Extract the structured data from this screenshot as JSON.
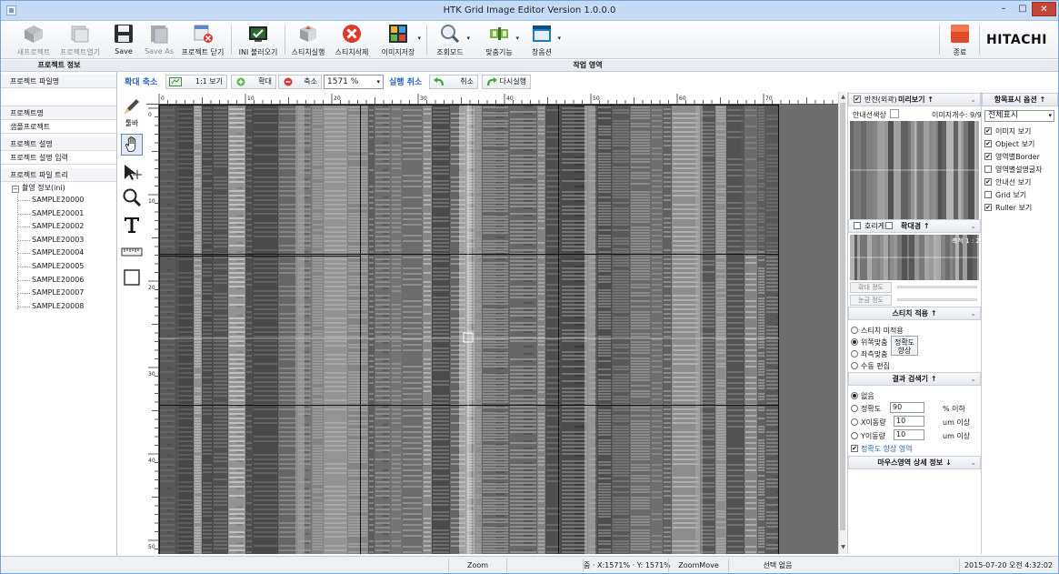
{
  "window": {
    "title": "HTK Grid Image Editor Version 1.0.0.0",
    "minimize": "–",
    "maximize": "□",
    "close": "✕"
  },
  "toolbar": {
    "new_project": "새프로젝트",
    "open_project": "프로젝트열기",
    "save": "Save",
    "save_as": "Save As",
    "close_project": "프로젝트 닫기",
    "load_ini": "INI 불러오기",
    "run_stitch": "스티치실행",
    "delete_stitch": "스티치삭제",
    "save_image": "이미지저장",
    "view_mode": "조회모드",
    "fit": "맞춤기능",
    "window": "창옵션",
    "exit": "종료",
    "brand": "HITACHI"
  },
  "left_panel": {
    "header": "프로젝트 정보",
    "project_file_label": "프로젝트 파일명",
    "project_name_label": "프로젝트명",
    "project_name_value": "샘플프로젝트",
    "project_desc_label": "프로젝트 설명",
    "project_desc_value": "프로젝트 설명 입력",
    "tree_label": "프로젝트 파일 트리",
    "tree_root": "촬영 정보(ini)",
    "tree_root_toggle": "−",
    "tree_items": [
      "SAMPLE20000",
      "SAMPLE20001",
      "SAMPLE20002",
      "SAMPLE20003",
      "SAMPLE20004",
      "SAMPLE20005",
      "SAMPLE20006",
      "SAMPLE20007",
      "SAMPLE20008"
    ]
  },
  "work_area": {
    "header": "작업 영역",
    "zoom_reduce_link": "확대 축소",
    "view_1to1": "1:1 보기",
    "zoom_in": "확대",
    "zoom_out": "축소",
    "zoom_value": "1571 %",
    "undo_link": "실행 취소",
    "undo": "취소",
    "redo": "다시실행",
    "tool_label": "툴바",
    "ruler_top_labels": [
      "0",
      "10",
      "20",
      "30",
      "40",
      "50",
      "60",
      "70"
    ],
    "ruler_left_labels": [
      "0",
      "10",
      "20",
      "30",
      "40",
      "50"
    ]
  },
  "preview_panel": {
    "invert_label": "반전(외곽)",
    "invert_checked": "✔",
    "preview_header": "미리보기 ↑",
    "guide_color_label": "안내선색상",
    "image_count": "이미지개수: 9/9",
    "smooth_label": "호리게",
    "magnifier_header": "확대경 ↑",
    "magnifier_scale": "축척 1 : 2",
    "zoom_strength": "확대 정도",
    "blur_strength": "눈금 정도",
    "stitch_header": "스티치 적용 ↑",
    "stitch_none": "스티치 미적용",
    "stitch_top": "위쪽맞춤",
    "stitch_side": "좌측맞춤",
    "stitch_manual": "수동 편집",
    "accuracy_button": "정확도 향상",
    "result_header": "결과 검색기 ↑",
    "result_none": "없음",
    "result_accuracy": "정확도",
    "result_accuracy_value": "90",
    "result_accuracy_unit": "% 이하",
    "result_x": "X이동량",
    "result_x_value": "10",
    "result_x_unit": "um 이상",
    "result_y": "Y이동량",
    "result_y_value": "10",
    "result_y_unit": "um 이상",
    "result_improve": "정확도 향상 영역",
    "result_improve_checked": "✔",
    "mouse_header": "마우스영역 상세 정보 ↓",
    "chevron": "⌄"
  },
  "display_options": {
    "header": "항목표시 옵션 ↑",
    "combo_value": "전체표시",
    "items": [
      {
        "label": "이미지 보기",
        "checked": "✔"
      },
      {
        "label": "Object 보기",
        "checked": "✔"
      },
      {
        "label": "영역별Border",
        "checked": "✔"
      },
      {
        "label": "영역별설명글자",
        "checked": ""
      },
      {
        "label": "안내선 보기",
        "checked": "✔"
      },
      {
        "label": "Grid 보기",
        "checked": ""
      },
      {
        "label": "Ruller 보기",
        "checked": "✔"
      }
    ]
  },
  "statusbar": {
    "mode": "Zoom",
    "zoom_info": "줌 · X:1571%  · Y: 1571%",
    "move_mode": "ZoomMove",
    "selection": "선택 없음",
    "datetime": "2015-07-20 오전 4:32:02"
  },
  "colors": {
    "title_bar": "#c5daf4",
    "link_blue": "#2a66b3",
    "close_red": "#c7463a",
    "canvas_gray": "#6b6b6b"
  }
}
